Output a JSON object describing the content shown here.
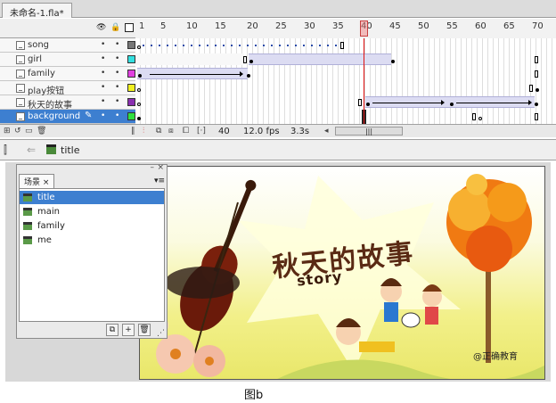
{
  "document_tab": "未命名-1.fla*",
  "timeline": {
    "header_icons": [
      "eye-icon",
      "lock-icon",
      "outline-icon"
    ],
    "ruler": [
      "1",
      "5",
      "10",
      "15",
      "20",
      "25",
      "30",
      "35",
      "40",
      "45",
      "50",
      "55",
      "60",
      "65",
      "70"
    ],
    "layers": [
      {
        "name": "song",
        "color": "#777777",
        "selected": false
      },
      {
        "name": "girl",
        "color": "#33e0e0",
        "selected": false
      },
      {
        "name": "family",
        "color": "#e040e0",
        "selected": false
      },
      {
        "name": "play按钮",
        "color": "#f0f020",
        "selected": false
      },
      {
        "name": "秋天的故事",
        "color": "#8a2fb0",
        "selected": false
      },
      {
        "name": "background",
        "color": "#30e040",
        "selected": true
      }
    ],
    "status": {
      "current_frame": "40",
      "fps": "12.0 fps",
      "time": "3.3s"
    }
  },
  "edit_bar": {
    "scene_name": "title"
  },
  "scene_panel": {
    "tab_label": "场景",
    "items": [
      {
        "name": "title",
        "selected": true
      },
      {
        "name": "main",
        "selected": false
      },
      {
        "name": "family",
        "selected": false
      },
      {
        "name": "me",
        "selected": false
      }
    ]
  },
  "stage": {
    "title_cn": "秋天的故事",
    "title_en": "story",
    "watermark": "@正确教育"
  },
  "caption": "图b"
}
